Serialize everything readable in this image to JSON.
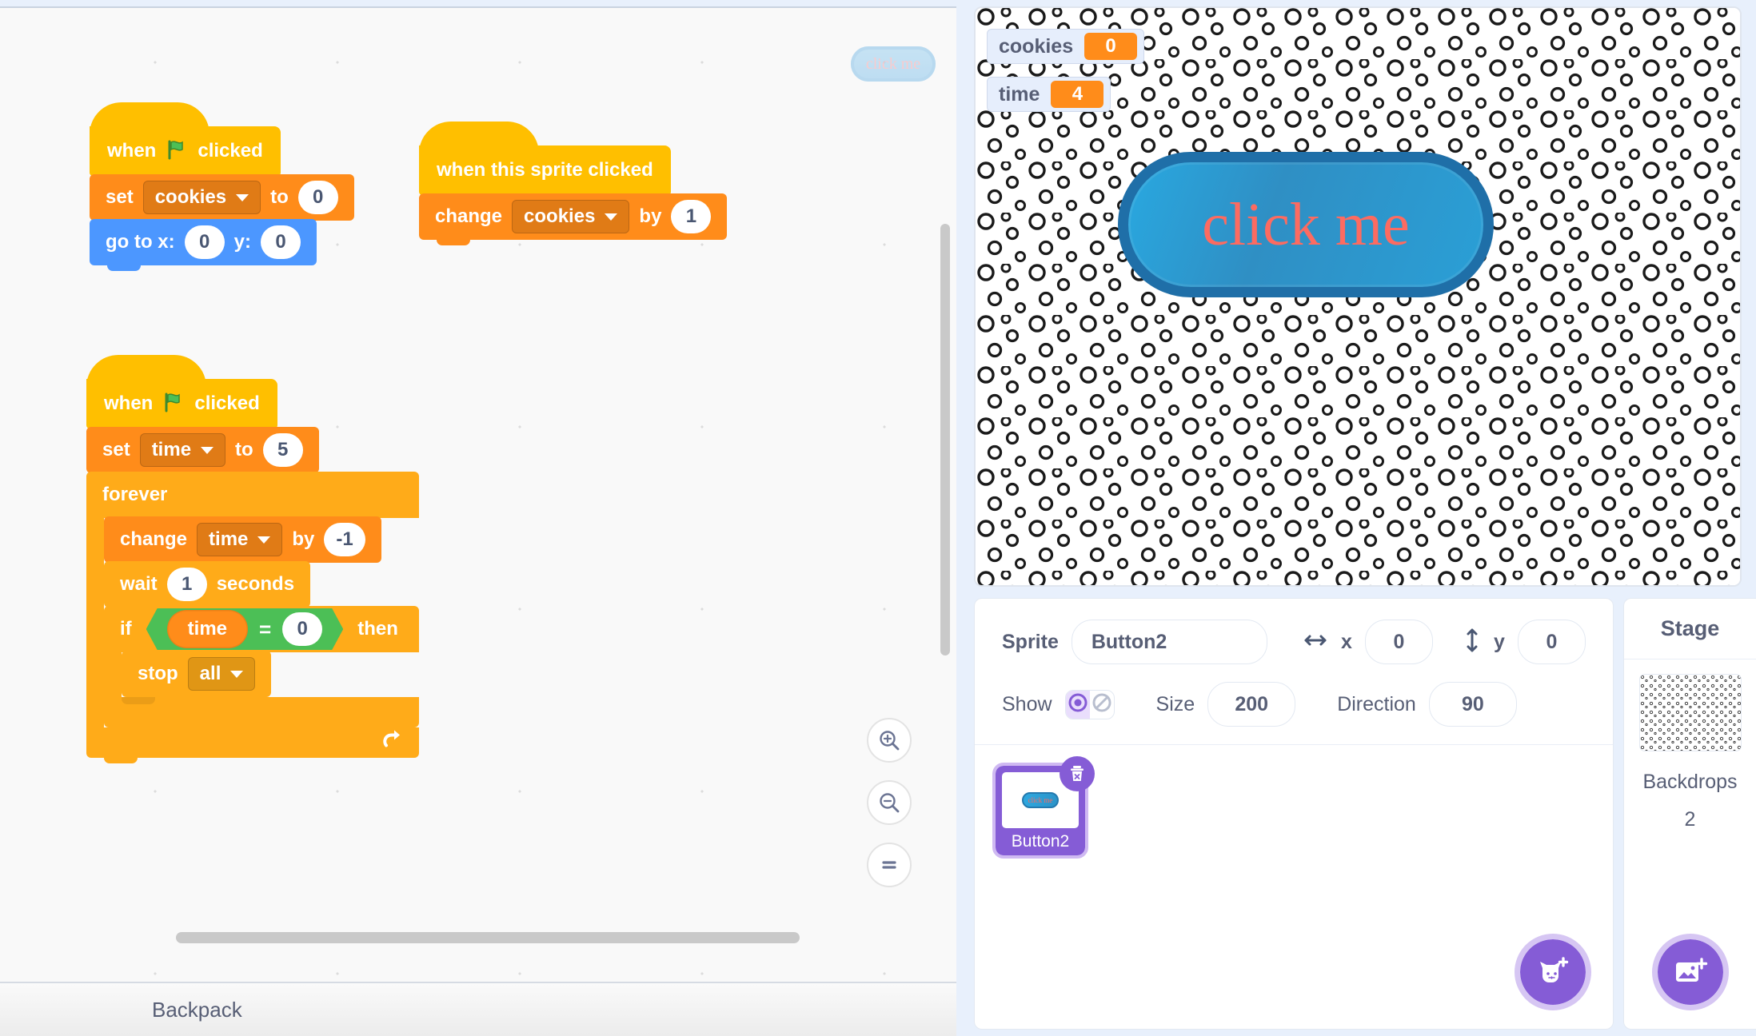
{
  "workspace": {
    "ghost_sprite_label": "click me",
    "scripts": [
      {
        "id": "script-green-flag-cookies",
        "hat": {
          "pre": "when",
          "icon": "green-flag-icon",
          "post": "clicked"
        },
        "blocks": [
          {
            "type": "set-variable",
            "label": "set",
            "variable": "cookies",
            "mid": "to",
            "value": "0"
          },
          {
            "type": "go-to-xy",
            "label": "go to x:",
            "x": "0",
            "ylabel": "y:",
            "y": "0"
          }
        ]
      },
      {
        "id": "script-sprite-clicked",
        "hat": {
          "pre": "when this sprite clicked",
          "icon": "",
          "post": ""
        },
        "blocks": [
          {
            "type": "change-variable",
            "label": "change",
            "variable": "cookies",
            "mid": "by",
            "value": "1"
          }
        ]
      },
      {
        "id": "script-green-flag-timer",
        "hat": {
          "pre": "when",
          "icon": "green-flag-icon",
          "post": "clicked"
        },
        "blocks": [
          {
            "type": "set-variable",
            "label": "set",
            "variable": "time",
            "mid": "to",
            "value": "5"
          },
          {
            "type": "forever",
            "label": "forever",
            "children": [
              {
                "type": "change-variable",
                "label": "change",
                "variable": "time",
                "mid": "by",
                "value": "-1"
              },
              {
                "type": "wait",
                "label": "wait",
                "value": "1",
                "suffix": "seconds"
              },
              {
                "type": "if-then",
                "label": "if",
                "then": "then",
                "condition": {
                  "left": "time",
                  "operator": "=",
                  "right": "0"
                },
                "children": [
                  {
                    "type": "stop",
                    "label": "stop",
                    "option": "all"
                  }
                ]
              }
            ]
          }
        ]
      }
    ],
    "zoom_controls": [
      {
        "name": "zoom-in-icon",
        "glyph": "+"
      },
      {
        "name": "zoom-out-icon",
        "glyph": "-"
      },
      {
        "name": "zoom-reset-icon",
        "glyph": "="
      }
    ],
    "backpack_label": "Backpack"
  },
  "stage": {
    "monitors": [
      {
        "name": "cookies",
        "value": "0"
      },
      {
        "name": "time",
        "value": "4"
      }
    ],
    "sprite_button_label": "click me",
    "button_fill": "#2a9fd6",
    "button_border": "#1f6fa8",
    "button_text_color": "#fc6b61"
  },
  "sprite_panel": {
    "sprite_label": "Sprite",
    "sprite_name": "Button2",
    "x_label": "x",
    "x_value": "0",
    "y_label": "y",
    "y_value": "0",
    "show_label": "Show",
    "size_label": "Size",
    "size_value": "200",
    "direction_label": "Direction",
    "direction_value": "90",
    "sprites": [
      {
        "name": "Button2",
        "thumb_label": "click me",
        "selected": true
      }
    ],
    "add_sprite_icon": "add-sprite-cat-icon"
  },
  "stage_panel": {
    "title": "Stage",
    "backdrops_label": "Backdrops",
    "backdrops_count": "2",
    "add_backdrop_icon": "add-backdrop-image-icon"
  },
  "theme": {
    "variable_orange": "#ff8c1a",
    "control_yellow": "#ffab19",
    "event_yellow": "#ffbf00",
    "motion_blue": "#4c97ff",
    "operator_green": "#4cbf56",
    "accent_purple": "#855cd6"
  }
}
